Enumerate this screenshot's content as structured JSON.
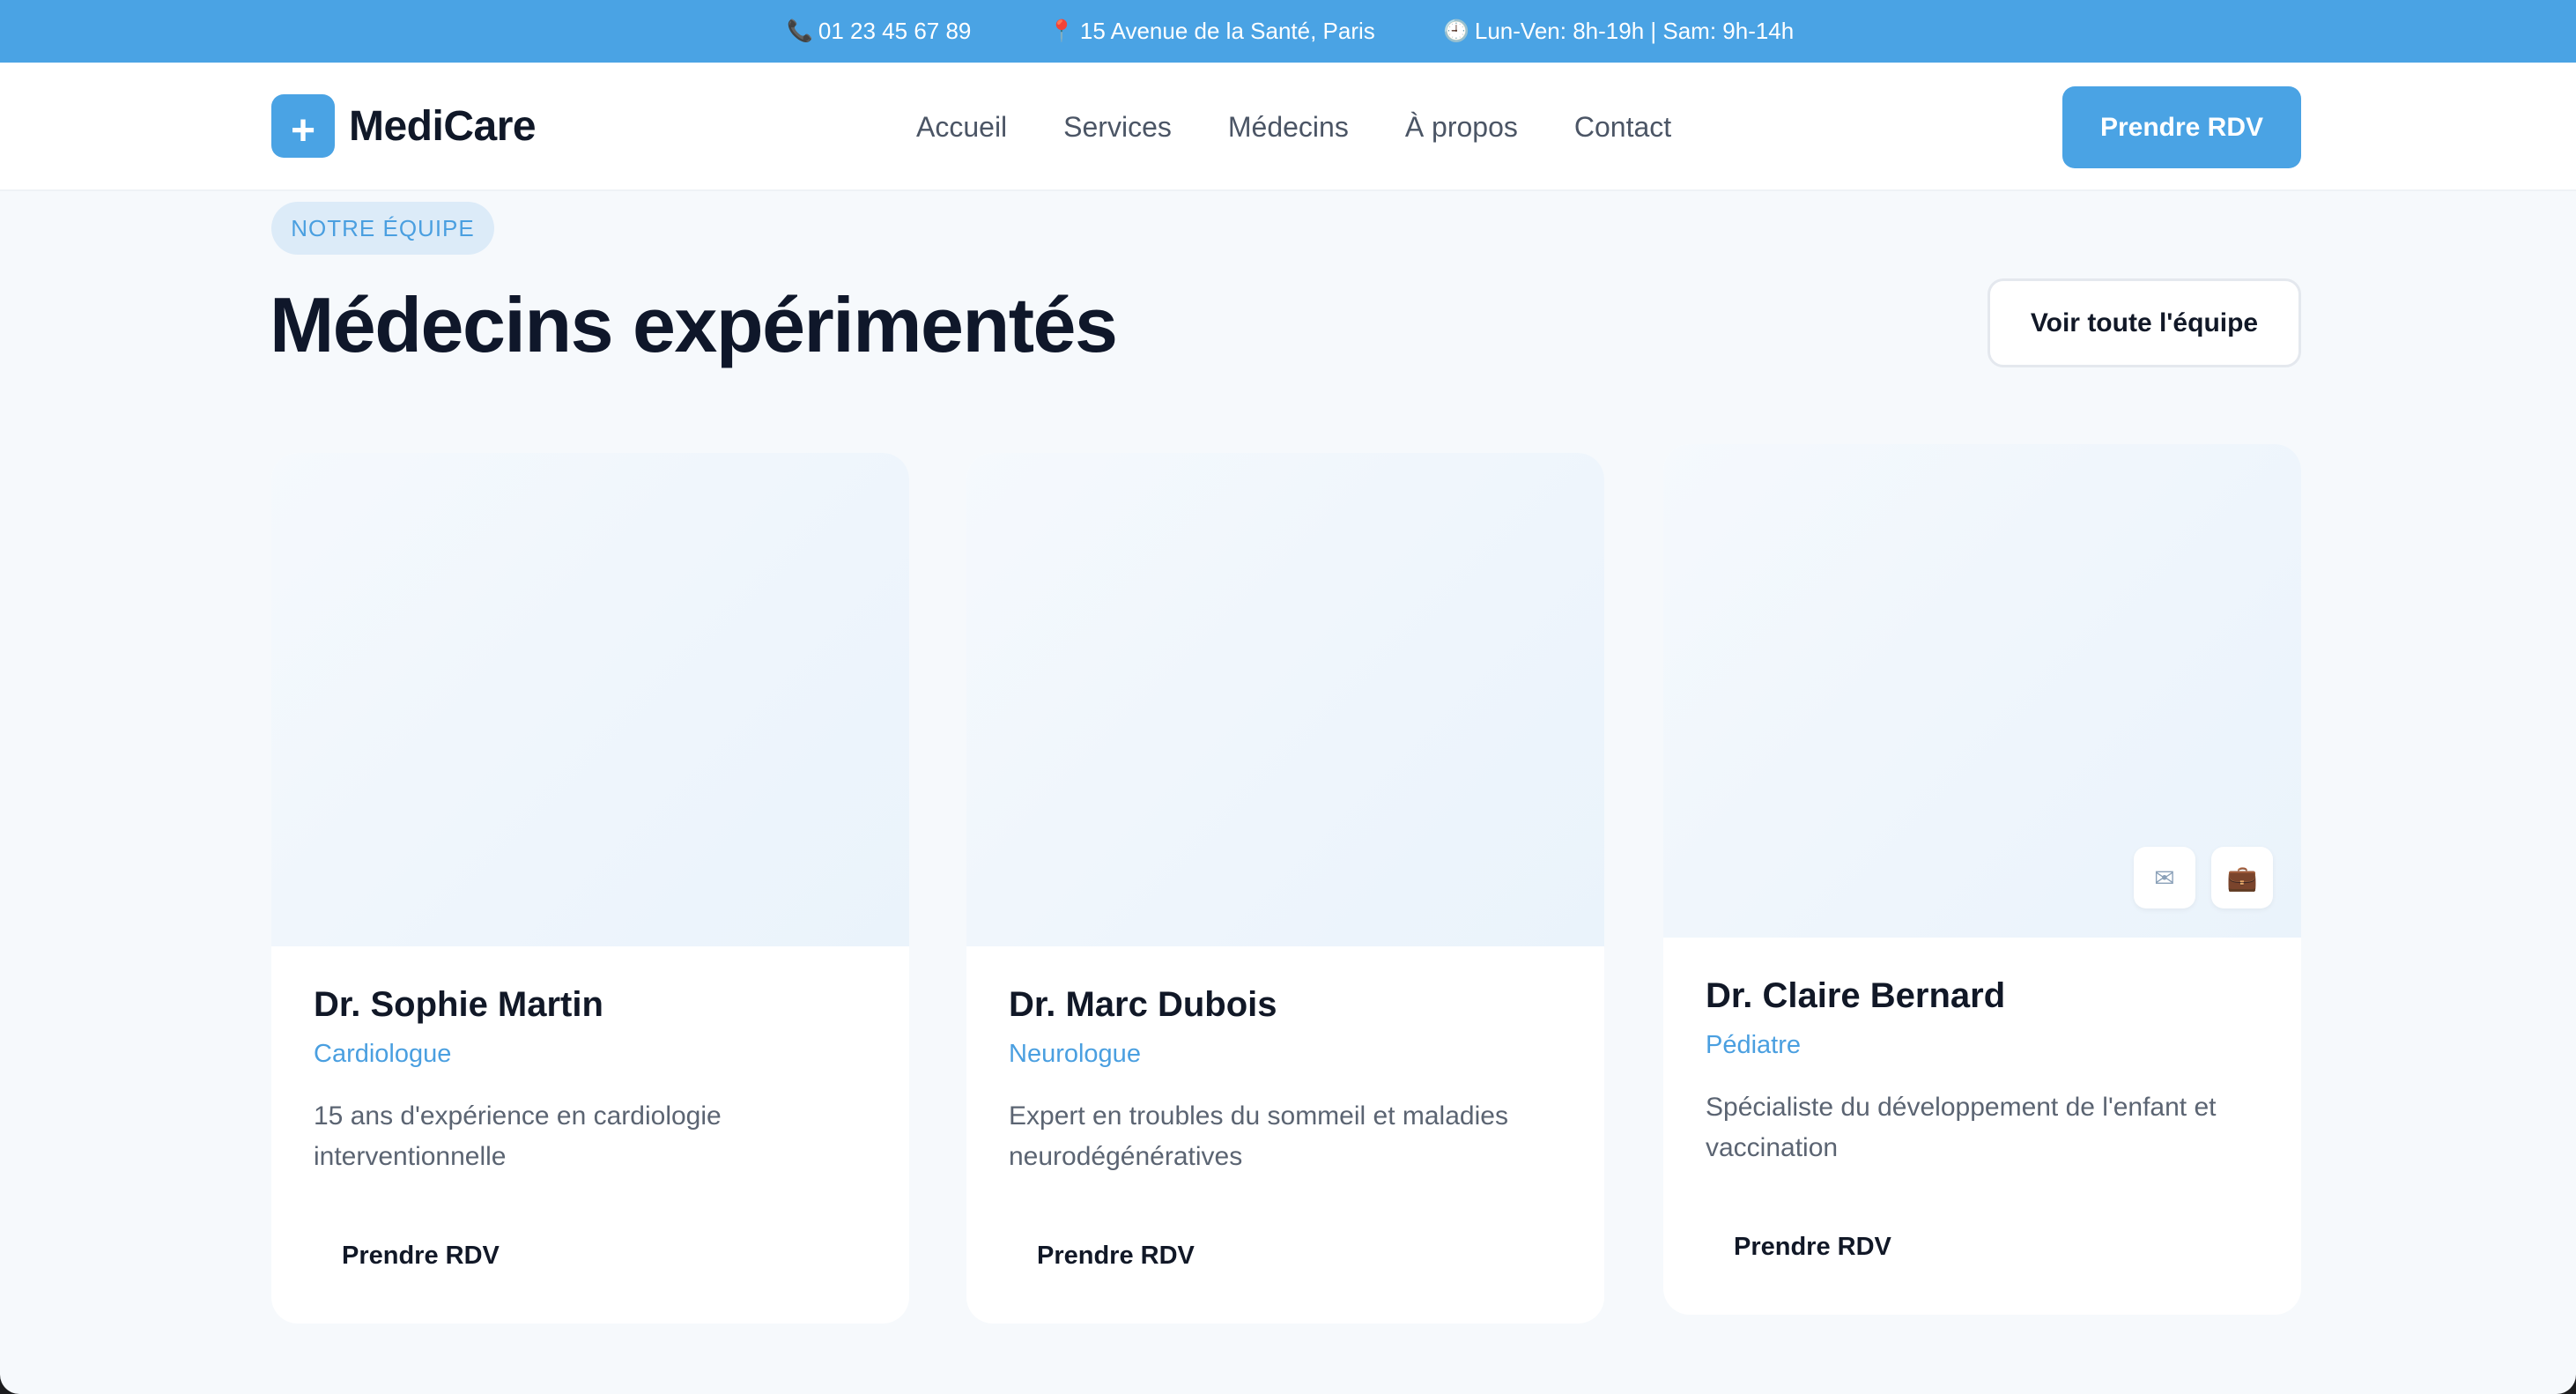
{
  "topbar": {
    "phone": "01 23 45 67 89",
    "address": "15 Avenue de la Santé, Paris",
    "hours": "Lun-Ven: 8h-19h | Sam: 9h-14h",
    "icons": {
      "phone": "phone-icon",
      "address": "map-pin-icon",
      "hours": "clock-icon"
    }
  },
  "header": {
    "logo_symbol": "+",
    "logo_text": "MediCare",
    "nav": [
      "Accueil",
      "Services",
      "Médecins",
      "À propos",
      "Contact"
    ],
    "cta": "Prendre RDV"
  },
  "section": {
    "tag": "NOTRE ÉQUIPE",
    "title": "Médecins expérimentés",
    "see_all": "Voir toute l'équipe"
  },
  "doctors": [
    {
      "name": "Dr. Sophie Martin",
      "specialty": "Cardiologue",
      "description": "15 ans d'expérience en cardiologie interventionnelle",
      "button": "Prendre RDV"
    },
    {
      "name": "Dr. Marc Dubois",
      "specialty": "Neurologue",
      "description": "Expert en troubles du sommeil et maladies neurodégénératives",
      "button": "Prendre RDV"
    },
    {
      "name": "Dr. Claire Bernard",
      "specialty": "Pédiatre",
      "description": "Spécialiste du développement de l'enfant et vaccination",
      "button": "Prendre RDV",
      "media_icons": [
        "mail-icon",
        "briefcase-icon"
      ]
    }
  ],
  "colors": {
    "primary": "#4aa3e4",
    "heading": "#0f172a",
    "text": "#5b6472",
    "background": "#f6f9fc"
  }
}
